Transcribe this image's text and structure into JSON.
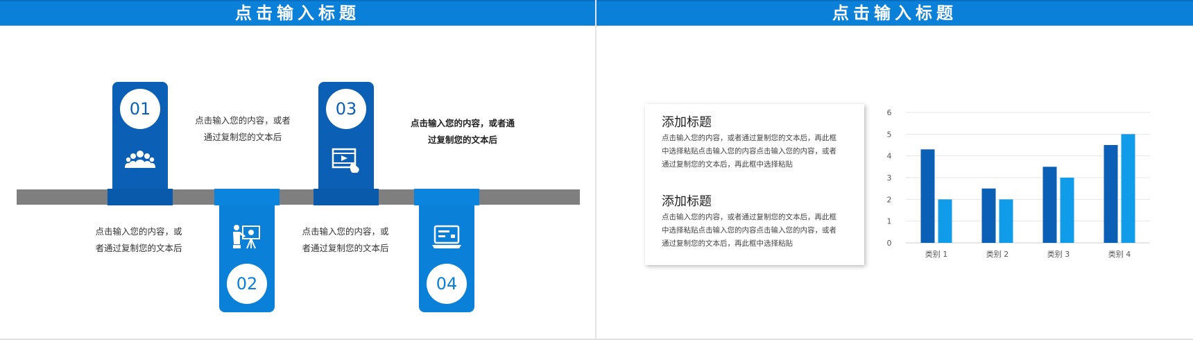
{
  "left_slide": {
    "header_title": "点击输入标题",
    "items": [
      {
        "number": "01",
        "icon": "team-icon",
        "text_line1": "点击输入您的内容，或者",
        "text_line2": "通过复制您的文本后"
      },
      {
        "number": "02",
        "icon": "presenter-icon",
        "text_line1": "点击输入您的内容，或",
        "text_line2": "者通过复制您的文本后"
      },
      {
        "number": "03",
        "icon": "video-icon",
        "text_line1": "点击输入您的内容，或",
        "text_line2": "者通过复制您的文本后"
      },
      {
        "number": "04",
        "icon": "laptop-icon",
        "text_line1": "点击输入您的内容，或者通",
        "text_line2": "过复制您的文本后"
      }
    ]
  },
  "right_slide": {
    "header_title": "点击输入标题",
    "blocks": [
      {
        "title": "添加标题",
        "body": [
          "点击输入您的内容，或者通过复制您的文本后，再此框",
          "中选择粘贴点击输入您的内容点击输入您的内容，或者",
          "通过复制您的文本后，再此框中选择粘贴"
        ]
      },
      {
        "title": "添加标题",
        "body": [
          "点击输入您的内容，或者通过复制您的文本后，再此框",
          "中选择粘贴点击输入您的内容点击输入您的内容，或者",
          "通过复制您的文本后，再此框中选择粘贴"
        ]
      }
    ]
  },
  "colors": {
    "header": "#0a80d8",
    "dark_blue": "#0b5fb5",
    "light_blue": "#0a80d8",
    "bar_gray": "#7f7f7f",
    "series1": "#0b5fb5",
    "series2": "#109ce8"
  },
  "chart_data": {
    "type": "bar",
    "categories": [
      "类别 1",
      "类别 2",
      "类别 3",
      "类别 4"
    ],
    "series": [
      {
        "values": [
          4.3,
          2.5,
          3.5,
          4.5
        ]
      },
      {
        "values": [
          2.0,
          2.0,
          3.0,
          5.0
        ]
      }
    ],
    "ylim": [
      0,
      6
    ],
    "yticks": [
      "0",
      "1",
      "2",
      "3",
      "4",
      "5",
      "6"
    ],
    "grid": true,
    "legend": "none"
  }
}
